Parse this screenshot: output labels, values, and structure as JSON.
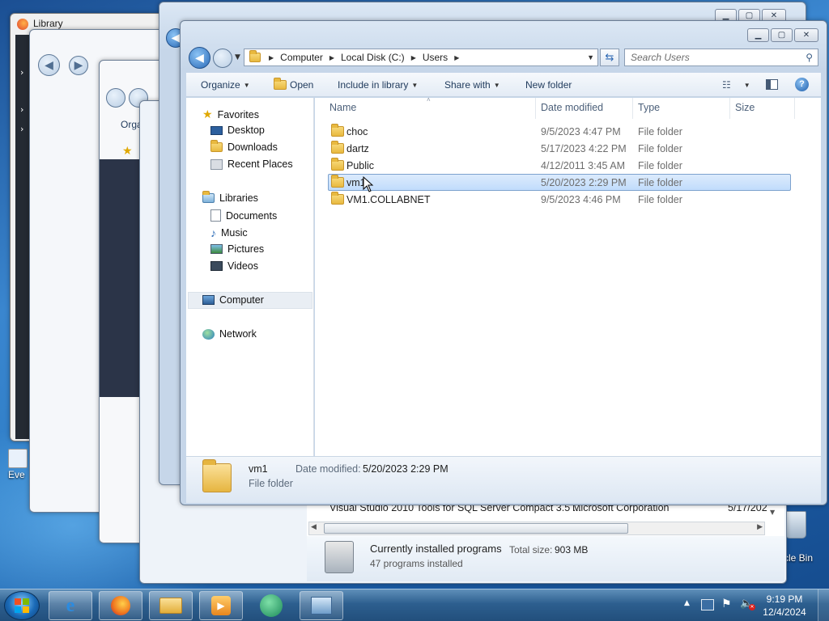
{
  "background_windows": {
    "library_title": "Library",
    "organize_short": "Orga"
  },
  "explorer": {
    "address": {
      "crumbs": [
        "Computer",
        "Local Disk (C:)",
        "Users"
      ]
    },
    "search_placeholder": "Search Users",
    "toolbar": {
      "organize": "Organize",
      "open": "Open",
      "include_in_library": "Include in library",
      "share_with": "Share with",
      "new_folder": "New folder"
    },
    "nav": {
      "favorites": "Favorites",
      "desktop": "Desktop",
      "downloads": "Downloads",
      "recent_places": "Recent Places",
      "libraries": "Libraries",
      "documents": "Documents",
      "music": "Music",
      "pictures": "Pictures",
      "videos": "Videos",
      "computer": "Computer",
      "network": "Network"
    },
    "columns": {
      "name": "Name",
      "date_modified": "Date modified",
      "type": "Type",
      "size": "Size"
    },
    "files": [
      {
        "name": "choc",
        "date": "9/5/2023 4:47 PM",
        "type": "File folder"
      },
      {
        "name": "dartz",
        "date": "5/17/2023 4:22 PM",
        "type": "File folder"
      },
      {
        "name": "Public",
        "date": "4/12/2011 3:45 AM",
        "type": "File folder"
      },
      {
        "name": "vm1",
        "date": "5/20/2023 2:29 PM",
        "type": "File folder"
      },
      {
        "name": "VM1.COLLABNET",
        "date": "9/5/2023 4:46 PM",
        "type": "File folder"
      }
    ],
    "details": {
      "name": "vm1",
      "date_label": "Date modified:",
      "date_value": "5/20/2023 2:29 PM",
      "type": "File folder"
    }
  },
  "programs": {
    "row_name": "Visual Studio 2010 Tools for SQL Server Compact 3.5 ...",
    "row_publisher": "Microsoft Corporation",
    "row_date": "5/17/202",
    "currently_installed": "Currently installed programs",
    "total_size_label": "Total size:",
    "total_size_value": "903 MB",
    "count": "47 programs installed"
  },
  "desktop": {
    "recycle_bin_label": "cle Bin",
    "everything_label": "Eve"
  },
  "taskbar": {
    "time": "9:19 PM",
    "date": "12/4/2024"
  }
}
